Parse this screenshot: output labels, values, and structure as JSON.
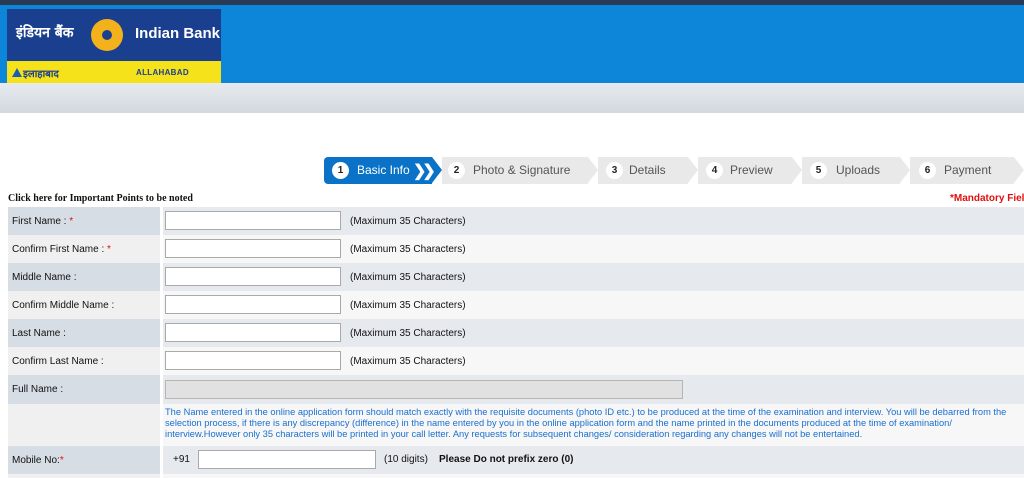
{
  "header": {
    "logo_hindi": "इंडियन बैंक",
    "logo_english": "Indian Bank",
    "logo_allahabad_hindi": "इलाहाबाद",
    "logo_allahabad_english": "ALLAHABAD"
  },
  "steps": [
    {
      "num": "1",
      "label": "Basic Info",
      "active": true
    },
    {
      "num": "2",
      "label": "Photo & Signature",
      "active": false
    },
    {
      "num": "3",
      "label": "Details",
      "active": false
    },
    {
      "num": "4",
      "label": "Preview",
      "active": false
    },
    {
      "num": "5",
      "label": "Uploads",
      "active": false
    },
    {
      "num": "6",
      "label": "Payment",
      "active": false
    }
  ],
  "important_link": "Click here for Important Points to be noted",
  "mandatory_note": "*Mandatory Field",
  "form": {
    "first_name": {
      "label": "First Name :",
      "required": "*",
      "value": "",
      "hint": "(Maximum 35 Characters)"
    },
    "confirm_first_name": {
      "label": "Confirm First Name :",
      "required": "*",
      "value": "",
      "hint": "(Maximum 35 Characters)"
    },
    "middle_name": {
      "label": "Middle Name :",
      "value": "",
      "hint": "(Maximum 35 Characters)"
    },
    "confirm_middle_name": {
      "label": "Confirm Middle Name :",
      "value": "",
      "hint": "(Maximum 35 Characters)"
    },
    "last_name": {
      "label": "Last Name :",
      "value": "",
      "hint": "(Maximum 35 Characters)"
    },
    "confirm_last_name": {
      "label": "Confirm Last Name :",
      "value": "",
      "hint": "(Maximum 35 Characters)"
    },
    "full_name": {
      "label": "Full Name :",
      "value": ""
    },
    "name_note": "The Name entered in the online application form should match exactly with the requisite documents (photo ID etc.) to be produced at the time of the examination and interview. You will be debarred from the selection process, if there is any discrepancy (difference) in the name entered by you in the online application form and the name printed in the documents produced at the time of examination/ interview.However only 35 characters will be printed in your call letter. Any requests for subsequent changes/ consideration regarding any changes will not be entertained.",
    "mobile": {
      "label": "Mobile No:",
      "required": "*",
      "prefix": "+91",
      "value": "",
      "hint": "(10 digits)",
      "warning": "Please Do not prefix zero (0)"
    }
  },
  "colors": {
    "header_blue": "#0d85d8",
    "step_active": "#0b73c7",
    "required_red": "#e01010",
    "note_blue": "#1a6fcf"
  }
}
